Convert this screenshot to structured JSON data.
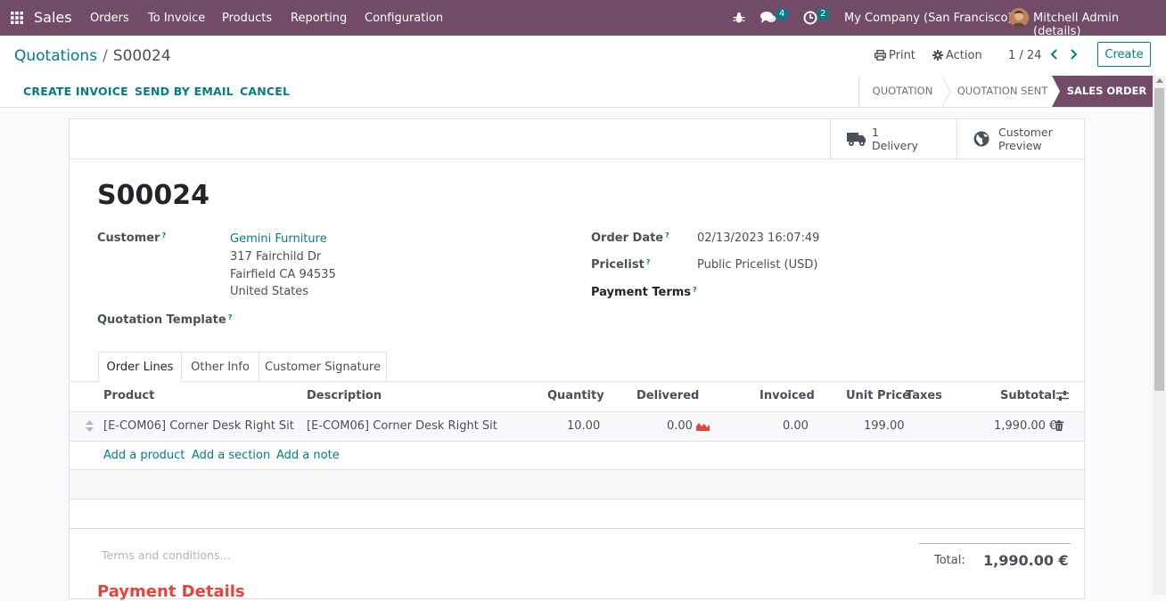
{
  "navbar": {
    "app_name": "Sales",
    "menus": [
      "Orders",
      "To Invoice",
      "Products",
      "Reporting",
      "Configuration"
    ],
    "messages_count": "4",
    "activities_count": "2",
    "company": "My Company (San Francisco)",
    "user": "Mitchell Admin (details)"
  },
  "breadcrumb": {
    "parent": "Quotations",
    "separator": "/",
    "current": "S00024"
  },
  "controls": {
    "print": "Print",
    "action": "Action",
    "pager": "1 / 24",
    "create": "Create"
  },
  "actions": {
    "create_invoice": "CREATE INVOICE",
    "send_email": "SEND BY EMAIL",
    "cancel": "CANCEL"
  },
  "stages": [
    "QUOTATION",
    "QUOTATION SENT",
    "SALES ORDER"
  ],
  "smart_buttons": {
    "delivery_count": "1",
    "delivery_label": "Delivery",
    "preview_line1": "Customer",
    "preview_line2": "Preview"
  },
  "record": {
    "name": "S00024",
    "customer_label": "Customer",
    "customer_name": "Gemini Furniture",
    "address": [
      "317 Fairchild Dr",
      "Fairfield CA 94535",
      "United States"
    ],
    "template_label": "Quotation Template",
    "order_date_label": "Order Date",
    "order_date": "02/13/2023 16:07:49",
    "pricelist_label": "Pricelist",
    "pricelist": "Public Pricelist (USD)",
    "payment_terms_label": "Payment Terms",
    "help_mark": "?"
  },
  "tabs": [
    "Order Lines",
    "Other Info",
    "Customer Signature"
  ],
  "table": {
    "headers": {
      "product": "Product",
      "description": "Description",
      "quantity": "Quantity",
      "delivered": "Delivered",
      "invoiced": "Invoiced",
      "unit_price": "Unit Price",
      "taxes": "Taxes",
      "subtotal": "Subtotal"
    },
    "rows": [
      {
        "product": "[E-COM06] Corner Desk Right Sit",
        "description": "[E-COM06] Corner Desk Right Sit",
        "quantity": "10.00",
        "delivered": "0.00",
        "invoiced": "0.00",
        "unit_price": "199.00",
        "taxes": "",
        "subtotal": "1,990.00 €"
      }
    ],
    "add_product": "Add a product",
    "add_section": "Add a section",
    "add_note": "Add a note"
  },
  "footer": {
    "terms_placeholder": "Terms and conditions...",
    "total_label": "Total:",
    "total_value": "1,990.00 €",
    "payment_details": "Payment Details"
  },
  "colors": {
    "brand": "#714b67",
    "accent": "#017e84",
    "danger": "#e8423b"
  }
}
